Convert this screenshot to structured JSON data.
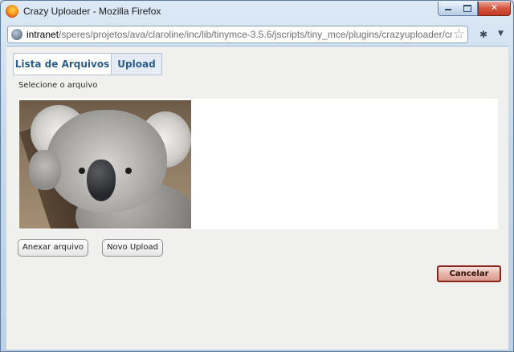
{
  "window": {
    "title": "Crazy Uploader - Mozilla Firefox",
    "controls": {
      "minimize": "",
      "maximize": "",
      "close": "✕"
    }
  },
  "urlbar": {
    "host": "intranet",
    "path": "/speres/projetos/ava/claroline/inc/lib/tinymce-3.5.6/jscripts/tiny_mce/plugins/crazyuploader/crazyuplo"
  },
  "tabs": [
    {
      "label": "Lista de Arquivos",
      "active": false
    },
    {
      "label": "Upload",
      "active": true
    }
  ],
  "upload": {
    "select_label": "Selecione o arquivo",
    "preview_image": "koala-photo",
    "attach_button": "Anexar arquivo",
    "new_upload_button": "Novo Upload",
    "cancel_button": "Cancelar"
  },
  "colors": {
    "tab_text": "#2b5c8a",
    "cancel_border": "#8a2318",
    "content_bg": "#f0f0ee"
  }
}
